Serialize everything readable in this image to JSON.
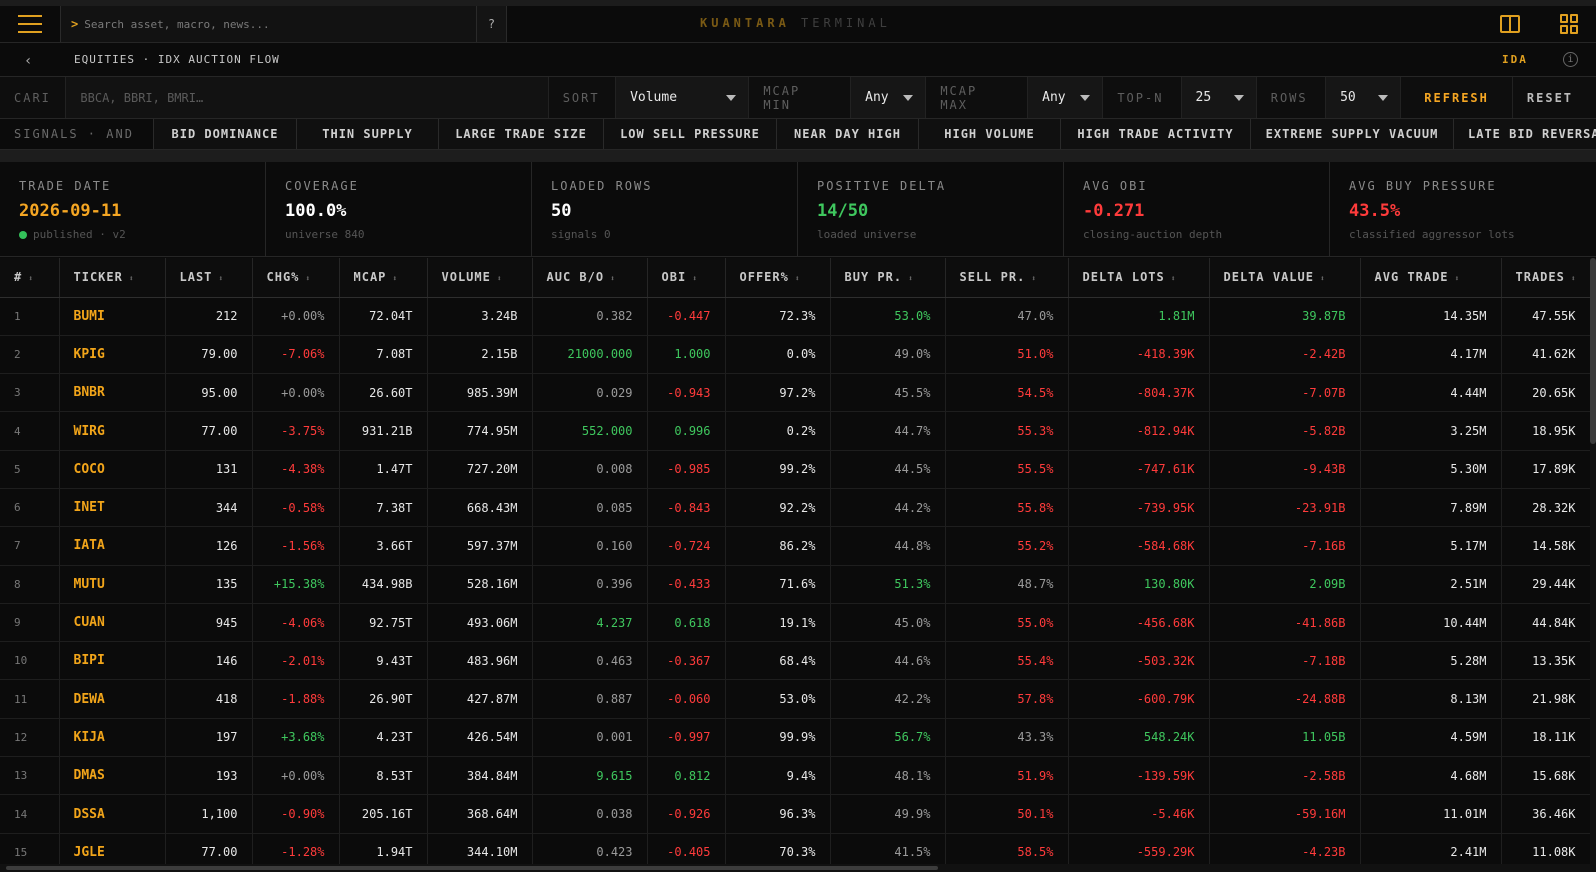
{
  "topbar": {
    "search_placeholder": "Search asset, macro, news...",
    "prompt": ">",
    "help": "?",
    "brand_primary": "KUANTARA",
    "brand_secondary": "TERMINAL"
  },
  "crumbbar": {
    "back": "‹",
    "breadcrumb": "EQUITIES · IDX AUCTION FLOW",
    "badge": "IDA",
    "info": "i"
  },
  "filters": {
    "search_label": "CARI",
    "search_placeholder": "BBCA, BBRI, BMRI…",
    "sort_label": "SORT",
    "sort_value": "Volume",
    "mcap_min_label": "MCAP MIN",
    "mcap_min_value": "Any",
    "mcap_max_label": "MCAP MAX",
    "mcap_max_value": "Any",
    "topn_label": "TOP-N",
    "topn_value": "25",
    "rows_label": "ROWS",
    "rows_value": "50",
    "refresh": "REFRESH",
    "reset": "RESET"
  },
  "signals": {
    "label": "SIGNALS · AND",
    "chips": [
      "BID DOMINANCE",
      "THIN SUPPLY",
      "LARGE TRADE SIZE",
      "LOW SELL PRESSURE",
      "NEAR DAY HIGH",
      "HIGH VOLUME",
      "HIGH TRADE ACTIVITY",
      "EXTREME SUPPLY VACUUM",
      "LATE BID REVERSAL"
    ]
  },
  "stats": [
    {
      "label": "TRADE DATE",
      "value": "2026-09-11",
      "sub": "published · v2",
      "color": "#f5a623"
    },
    {
      "label": "COVERAGE",
      "value": "100.0%",
      "sub": "universe 840",
      "color": "#ffffff"
    },
    {
      "label": "LOADED ROWS",
      "value": "50",
      "sub": "signals 0",
      "color": "#ffffff"
    },
    {
      "label": "POSITIVE DELTA",
      "value": "14/50",
      "sub": "loaded universe",
      "color": "#3fc75e"
    },
    {
      "label": "AVG OBI",
      "value": "-0.271",
      "sub": "closing-auction depth",
      "color": "#ff3b3b"
    },
    {
      "label": "AVG BUY PRESSURE",
      "value": "43.5%",
      "sub": "classified aggressor lots",
      "color": "#ff3b3b"
    }
  ],
  "table": {
    "headers": [
      "#",
      "TICKER",
      "LAST",
      "CHG%",
      "MCAP",
      "VOLUME",
      "AUC B/O",
      "OBI",
      "OFFER%",
      "BUY PR.",
      "SELL PR.",
      "DELTA LOTS",
      "DELTA VALUE",
      "AVG TRADE",
      "TRADES"
    ],
    "sort_icon": "⬍",
    "rows": [
      {
        "n": "1",
        "ticker": "BUMI",
        "last": "212",
        "chg": "+0.00%",
        "mcap": "72.04T",
        "volume": "3.24B",
        "auc": "0.382",
        "obi": "-0.447",
        "offer": "72.3%",
        "buy": "53.0%",
        "sell": "47.0%",
        "dlots": "1.81M",
        "dval": "39.87B",
        "avg": "14.35M",
        "trades": "47.55K"
      },
      {
        "n": "2",
        "ticker": "KPIG",
        "last": "79.00",
        "chg": "-7.06%",
        "mcap": "7.08T",
        "volume": "2.15B",
        "auc": "21000.000",
        "obi": "1.000",
        "offer": "0.0%",
        "buy": "49.0%",
        "sell": "51.0%",
        "dlots": "-418.39K",
        "dval": "-2.42B",
        "avg": "4.17M",
        "trades": "41.62K"
      },
      {
        "n": "3",
        "ticker": "BNBR",
        "last": "95.00",
        "chg": "+0.00%",
        "mcap": "26.60T",
        "volume": "985.39M",
        "auc": "0.029",
        "obi": "-0.943",
        "offer": "97.2%",
        "buy": "45.5%",
        "sell": "54.5%",
        "dlots": "-804.37K",
        "dval": "-7.07B",
        "avg": "4.44M",
        "trades": "20.65K"
      },
      {
        "n": "4",
        "ticker": "WIRG",
        "last": "77.00",
        "chg": "-3.75%",
        "mcap": "931.21B",
        "volume": "774.95M",
        "auc": "552.000",
        "obi": "0.996",
        "offer": "0.2%",
        "buy": "44.7%",
        "sell": "55.3%",
        "dlots": "-812.94K",
        "dval": "-5.82B",
        "avg": "3.25M",
        "trades": "18.95K"
      },
      {
        "n": "5",
        "ticker": "COCO",
        "last": "131",
        "chg": "-4.38%",
        "mcap": "1.47T",
        "volume": "727.20M",
        "auc": "0.008",
        "obi": "-0.985",
        "offer": "99.2%",
        "buy": "44.5%",
        "sell": "55.5%",
        "dlots": "-747.61K",
        "dval": "-9.43B",
        "avg": "5.30M",
        "trades": "17.89K"
      },
      {
        "n": "6",
        "ticker": "INET",
        "last": "344",
        "chg": "-0.58%",
        "mcap": "7.38T",
        "volume": "668.43M",
        "auc": "0.085",
        "obi": "-0.843",
        "offer": "92.2%",
        "buy": "44.2%",
        "sell": "55.8%",
        "dlots": "-739.95K",
        "dval": "-23.91B",
        "avg": "7.89M",
        "trades": "28.32K"
      },
      {
        "n": "7",
        "ticker": "IATA",
        "last": "126",
        "chg": "-1.56%",
        "mcap": "3.66T",
        "volume": "597.37M",
        "auc": "0.160",
        "obi": "-0.724",
        "offer": "86.2%",
        "buy": "44.8%",
        "sell": "55.2%",
        "dlots": "-584.68K",
        "dval": "-7.16B",
        "avg": "5.17M",
        "trades": "14.58K"
      },
      {
        "n": "8",
        "ticker": "MUTU",
        "last": "135",
        "chg": "+15.38%",
        "mcap": "434.98B",
        "volume": "528.16M",
        "auc": "0.396",
        "obi": "-0.433",
        "offer": "71.6%",
        "buy": "51.3%",
        "sell": "48.7%",
        "dlots": "130.80K",
        "dval": "2.09B",
        "avg": "2.51M",
        "trades": "29.44K"
      },
      {
        "n": "9",
        "ticker": "CUAN",
        "last": "945",
        "chg": "-4.06%",
        "mcap": "92.75T",
        "volume": "493.06M",
        "auc": "4.237",
        "obi": "0.618",
        "offer": "19.1%",
        "buy": "45.0%",
        "sell": "55.0%",
        "dlots": "-456.68K",
        "dval": "-41.86B",
        "avg": "10.44M",
        "trades": "44.84K"
      },
      {
        "n": "10",
        "ticker": "BIPI",
        "last": "146",
        "chg": "-2.01%",
        "mcap": "9.43T",
        "volume": "483.96M",
        "auc": "0.463",
        "obi": "-0.367",
        "offer": "68.4%",
        "buy": "44.6%",
        "sell": "55.4%",
        "dlots": "-503.32K",
        "dval": "-7.18B",
        "avg": "5.28M",
        "trades": "13.35K"
      },
      {
        "n": "11",
        "ticker": "DEWA",
        "last": "418",
        "chg": "-1.88%",
        "mcap": "26.90T",
        "volume": "427.87M",
        "auc": "0.887",
        "obi": "-0.060",
        "offer": "53.0%",
        "buy": "42.2%",
        "sell": "57.8%",
        "dlots": "-600.79K",
        "dval": "-24.88B",
        "avg": "8.13M",
        "trades": "21.98K"
      },
      {
        "n": "12",
        "ticker": "KIJA",
        "last": "197",
        "chg": "+3.68%",
        "mcap": "4.23T",
        "volume": "426.54M",
        "auc": "0.001",
        "obi": "-0.997",
        "offer": "99.9%",
        "buy": "56.7%",
        "sell": "43.3%",
        "dlots": "548.24K",
        "dval": "11.05B",
        "avg": "4.59M",
        "trades": "18.11K"
      },
      {
        "n": "13",
        "ticker": "DMAS",
        "last": "193",
        "chg": "+0.00%",
        "mcap": "8.53T",
        "volume": "384.84M",
        "auc": "9.615",
        "obi": "0.812",
        "offer": "9.4%",
        "buy": "48.1%",
        "sell": "51.9%",
        "dlots": "-139.59K",
        "dval": "-2.58B",
        "avg": "4.68M",
        "trades": "15.68K"
      },
      {
        "n": "14",
        "ticker": "DSSA",
        "last": "1,100",
        "chg": "-0.90%",
        "mcap": "205.16T",
        "volume": "368.64M",
        "auc": "0.038",
        "obi": "-0.926",
        "offer": "96.3%",
        "buy": "49.9%",
        "sell": "50.1%",
        "dlots": "-5.46K",
        "dval": "-59.16M",
        "avg": "11.01M",
        "trades": "36.46K"
      },
      {
        "n": "15",
        "ticker": "JGLE",
        "last": "77.00",
        "chg": "-1.28%",
        "mcap": "1.94T",
        "volume": "344.10M",
        "auc": "0.423",
        "obi": "-0.405",
        "offer": "70.3%",
        "buy": "41.5%",
        "sell": "58.5%",
        "dlots": "-559.29K",
        "dval": "-4.23B",
        "avg": "2.41M",
        "trades": "11.08K"
      }
    ]
  },
  "colors": {
    "accent": "#e0a020",
    "positive": "#3fc75e",
    "negative": "#ff3b3b",
    "neutral": "#9a9a9a"
  }
}
